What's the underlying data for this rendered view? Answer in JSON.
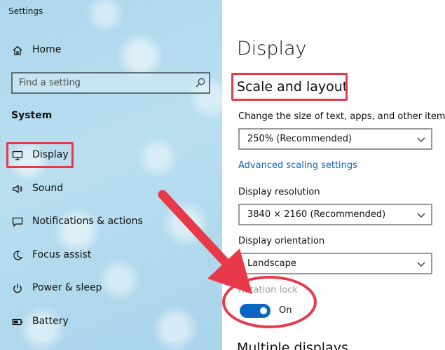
{
  "window": {
    "title": "Settings"
  },
  "sidebar": {
    "home_label": "Home",
    "search_placeholder": "Find a setting",
    "section_label": "System",
    "items": [
      {
        "label": "Display",
        "icon": "monitor-icon",
        "active": true
      },
      {
        "label": "Sound",
        "icon": "speaker-icon"
      },
      {
        "label": "Notifications & actions",
        "icon": "message-icon"
      },
      {
        "label": "Focus assist",
        "icon": "moon-icon"
      },
      {
        "label": "Power & sleep",
        "icon": "power-icon"
      },
      {
        "label": "Battery",
        "icon": "battery-icon"
      }
    ]
  },
  "main": {
    "page_title": "Display",
    "scale_section": {
      "heading": "Scale and layout",
      "scale_label": "Change the size of text, apps, and other items",
      "scale_value": "250% (Recommended)",
      "advanced_link": "Advanced scaling settings",
      "resolution_label": "Display resolution",
      "resolution_value": "3840 × 2160 (Recommended)",
      "orientation_label": "Display orientation",
      "orientation_value": "Landscape",
      "rotation_lock_label": "Rotation lock",
      "rotation_lock_state": "On"
    },
    "next_section_heading": "Multiple displays"
  },
  "colors": {
    "accent": "#0a66c2",
    "annotation_red": "#e8394a",
    "sidebar_bg": "#b9dff0"
  }
}
